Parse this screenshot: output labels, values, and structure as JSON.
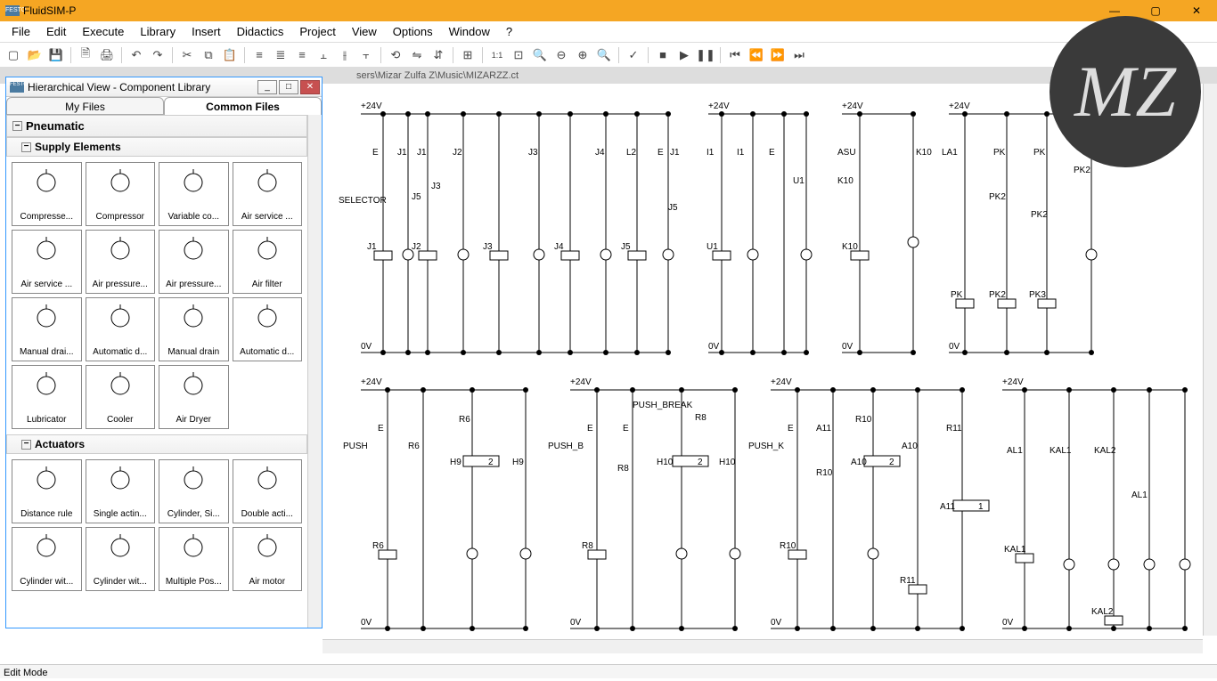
{
  "window": {
    "title": "FluidSIM-P",
    "icon_label": "FESTO"
  },
  "menu": [
    "File",
    "Edit",
    "Execute",
    "Library",
    "Insert",
    "Didactics",
    "Project",
    "View",
    "Options",
    "Window",
    "?"
  ],
  "doc_path": "sers\\Mizar Zulfa Z\\Music\\MIZARZZ.ct",
  "library_panel": {
    "title": "Hierarchical View - Component Library",
    "tabs": {
      "my_files": "My Files",
      "common_files": "Common Files"
    },
    "categories": {
      "pneumatic": "Pneumatic",
      "supply": "Supply Elements",
      "actuators": "Actuators"
    },
    "supply_items": [
      "Compresse...",
      "Compressor",
      "Variable co...",
      "Air service ...",
      "Air service ...",
      "Air pressure...",
      "Air pressure...",
      "Air filter",
      "Manual drai...",
      "Automatic d...",
      "Manual drain",
      "Automatic d...",
      "Lubricator",
      "Cooler",
      "Air Dryer"
    ],
    "actuator_items": [
      "Distance rule",
      "Single actin...",
      "Cylinder, Si...",
      "Double acti...",
      "Cylinder wit...",
      "Cylinder wit...",
      "Multiple Pos...",
      "Air motor"
    ]
  },
  "status": "Edit Mode",
  "circuit_labels": {
    "p24v": "+24V",
    "v0": "0V",
    "selector": "SELECTOR",
    "e": "E",
    "j1": "J1",
    "j2": "J2",
    "j3": "J3",
    "j4": "J4",
    "j5": "J5",
    "l2": "L2",
    "i1": "I1",
    "u1": "U1",
    "asu": "ASU",
    "k10": "K10",
    "la1": "LA1",
    "pk": "PK",
    "pk2": "PK2",
    "pk3": "PK3",
    "push": "PUSH",
    "push_b": "PUSH_B",
    "push_k": "PUSH_K",
    "push_break": "PUSH_BREAK",
    "r6": "R6",
    "r8": "R8",
    "r10": "R10",
    "r11": "R11",
    "a10": "A10",
    "a11": "A11",
    "h9": "H9",
    "h10": "H10",
    "two": "2",
    "one": "1",
    "al1": "AL1",
    "kal1": "KAL1",
    "kal2": "KAL2"
  },
  "badge": "MZ"
}
